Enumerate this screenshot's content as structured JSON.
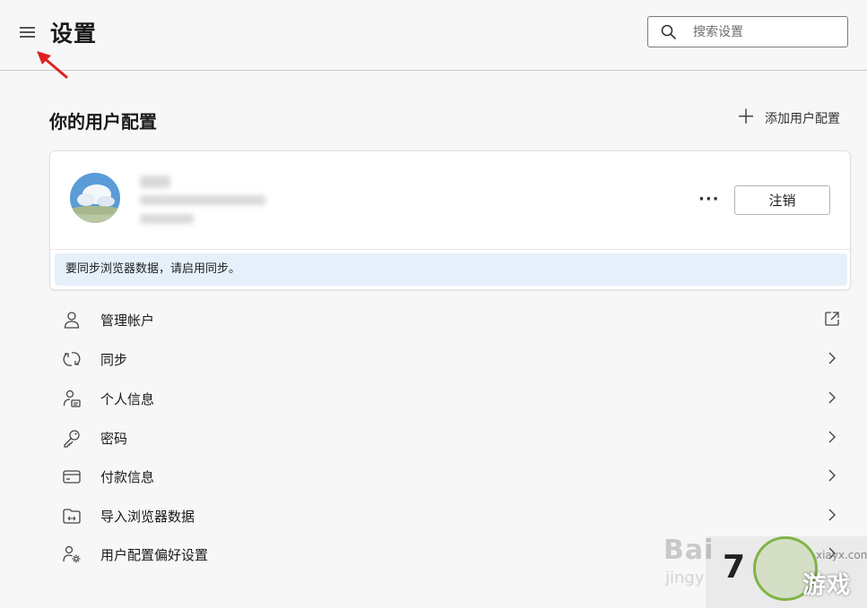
{
  "header": {
    "title": "设置",
    "search_placeholder": "搜索设置"
  },
  "profiles": {
    "section_title": "你的用户配置",
    "add_label": "添加用户配置",
    "card": {
      "more_label": "···",
      "sign_out_label": "注销",
      "sync_notice": "要同步浏览器数据，请启用同步。"
    }
  },
  "menu_items": [
    {
      "label": "管理帐户",
      "icon": "person-icon",
      "trail": "external-link-icon"
    },
    {
      "label": "同步",
      "icon": "sync-icon",
      "trail": "chevron-right-icon"
    },
    {
      "label": "个人信息",
      "icon": "personal-info-icon",
      "trail": "chevron-right-icon"
    },
    {
      "label": "密码",
      "icon": "key-icon",
      "trail": "chevron-right-icon"
    },
    {
      "label": "付款信息",
      "icon": "credit-card-icon",
      "trail": "chevron-right-icon"
    },
    {
      "label": "导入浏览器数据",
      "icon": "import-icon",
      "trail": "chevron-right-icon"
    },
    {
      "label": "用户配置偏好设置",
      "icon": "profile-settings-icon",
      "trail": "chevron-right-icon"
    }
  ],
  "watermark": {
    "baidu": "Bai",
    "jinyan": "jingy",
    "number": "7",
    "site": "xiayx.com",
    "brand": "游戏"
  },
  "colors": {
    "notice_bg": "#e6f0fa",
    "annotation_arrow": "#e02020",
    "page_bg": "#f7f7f7"
  }
}
